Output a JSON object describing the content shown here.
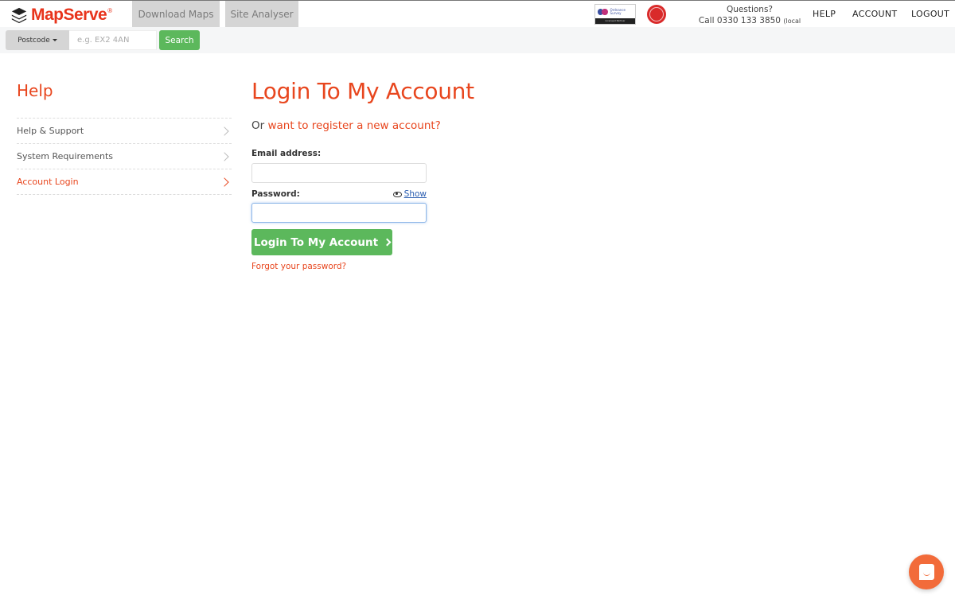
{
  "header": {
    "brand": "MapServe",
    "brand_mark": "®",
    "tabs": [
      {
        "label": "Download Maps"
      },
      {
        "label": "Site Analyser"
      }
    ],
    "partners": {
      "os_name": "Ordnance Survey",
      "os_badge": "Licensed Partner",
      "seal_glyph": "卌"
    },
    "questions_label": "Questions?",
    "phone_prefix": "Call 0330 133 3850",
    "phone_note": "(local rate)",
    "nav": {
      "help": "HELP",
      "account": "ACCOUNT",
      "logout": "LOGOUT"
    }
  },
  "searchbar": {
    "type_label": "Postcode",
    "placeholder": "e.g. EX2 4AN",
    "value": "",
    "search_label": "Search"
  },
  "sidebar": {
    "title": "Help",
    "items": [
      {
        "label": "Help & Support",
        "active": false
      },
      {
        "label": "System Requirements",
        "active": false
      },
      {
        "label": "Account Login",
        "active": true
      }
    ]
  },
  "main": {
    "title": "Login To My Account",
    "register_prefix": "Or",
    "register_link": "want to register a new account?",
    "email_label": "Email address:",
    "email_value": "",
    "password_label": "Password:",
    "password_value": "",
    "show_label": "Show",
    "login_button": "Login To My Account",
    "forgot_link": "Forgot your password?"
  },
  "colors": {
    "brand": "#e8341c",
    "accent": "#e8461e",
    "primary_button": "#5cb85c",
    "chat": "#f26b3a"
  }
}
